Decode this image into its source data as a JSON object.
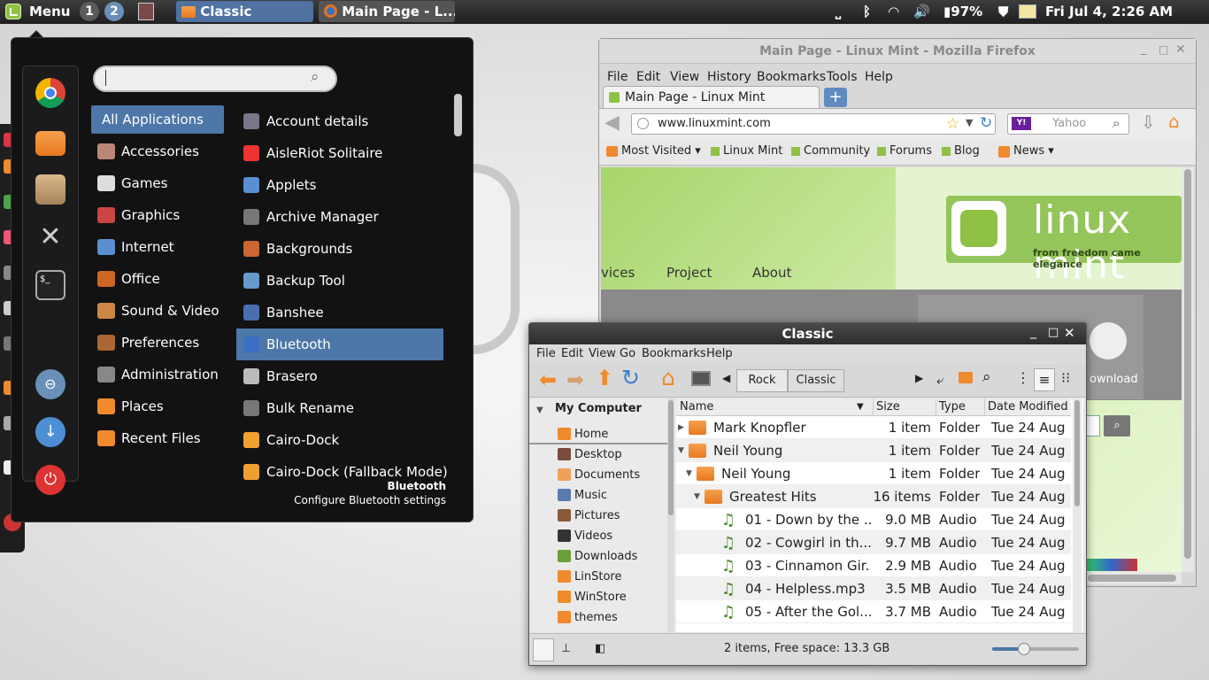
{
  "panel": {
    "menu_label": "Menu",
    "workspaces": [
      "1",
      "2"
    ],
    "tasks": [
      {
        "label": "Classic"
      },
      {
        "label": "Main Page - L..."
      }
    ],
    "battery": "97%",
    "clock": "Fri Jul  4,  2:26 AM"
  },
  "menu": {
    "categories": [
      "All Applications",
      "Accessories",
      "Games",
      "Graphics",
      "Internet",
      "Office",
      "Sound & Video",
      "Preferences",
      "Administration",
      "Places",
      "Recent Files"
    ],
    "apps": [
      "Account details",
      "AisleRiot Solitaire",
      "Applets",
      "Archive Manager",
      "Backgrounds",
      "Backup Tool",
      "Banshee",
      "Bluetooth",
      "Brasero",
      "Bulk Rename",
      "Cairo-Dock",
      "Cairo-Dock (Fallback Mode)"
    ],
    "info_title": "Bluetooth",
    "info_desc": "Configure Bluetooth settings"
  },
  "firefox": {
    "title": "Main Page - Linux Mint - Mozilla Firefox",
    "menus": [
      "File",
      "Edit",
      "View",
      "History",
      "Bookmarks",
      "Tools",
      "Help"
    ],
    "tab": "Main Page - Linux Mint",
    "url": "www.linuxmint.com",
    "search_placeholder": "Yahoo",
    "bookmarks": [
      "Most Visited ▾",
      "Linux Mint",
      "Community",
      "Forums",
      "Blog",
      "News ▾"
    ],
    "nav": [
      "vices",
      "Project",
      "About"
    ],
    "brand": "linux mint",
    "tagline": "from freedom came elegance",
    "download": "ownload"
  },
  "nemo": {
    "title": "Classic",
    "menus": [
      "File",
      "Edit",
      "View",
      "Go",
      "Bookmarks",
      "Help"
    ],
    "path": [
      "Rock",
      "Classic"
    ],
    "sidebar_header": "My Computer",
    "sidebar": [
      "Home",
      "Desktop",
      "Documents",
      "Music",
      "Pictures",
      "Videos",
      "Downloads",
      "LinStore",
      "WinStore",
      "themes"
    ],
    "columns": [
      "Name",
      "Size",
      "Type",
      "Date Modified"
    ],
    "rows": [
      {
        "name": "Mark Knopfler",
        "size": "1 item",
        "type": "Folder",
        "date": "Tue 24 Aug"
      },
      {
        "name": "Neil Young",
        "size": "1 item",
        "type": "Folder",
        "date": "Tue 24 Aug"
      },
      {
        "name": "Neil Young",
        "size": "1 item",
        "type": "Folder",
        "date": "Tue 24 Aug"
      },
      {
        "name": "Greatest Hits",
        "size": "16 items",
        "type": "Folder",
        "date": "Tue 24 Aug"
      },
      {
        "name": "01 - Down by the ...",
        "size": "9.0 MB",
        "type": "Audio",
        "date": "Tue 24 Aug"
      },
      {
        "name": "02 - Cowgirl in th...",
        "size": "9.7 MB",
        "type": "Audio",
        "date": "Tue 24 Aug"
      },
      {
        "name": "03 - Cinnamon Gir...",
        "size": "2.9 MB",
        "type": "Audio",
        "date": "Tue 24 Aug"
      },
      {
        "name": "04 - Helpless.mp3",
        "size": "3.5 MB",
        "type": "Audio",
        "date": "Tue 24 Aug"
      },
      {
        "name": "05 - After the Gol...",
        "size": "3.7 MB",
        "type": "Audio",
        "date": "Tue 24 Aug"
      }
    ],
    "status": "2 items, Free space: 13.3 GB"
  },
  "colors": {
    "accent": "#4d77a8",
    "mint": "#8fc144",
    "folder": "#f0892d"
  }
}
